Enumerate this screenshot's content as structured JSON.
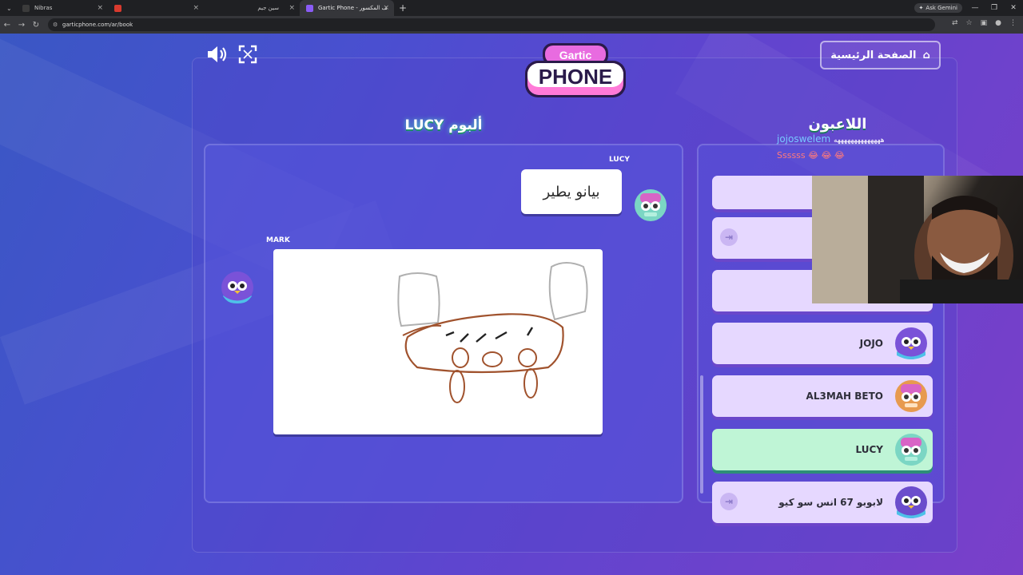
{
  "browser": {
    "tabs": [
      {
        "label": "Nibras",
        "favicon_color": "#3b3b3b"
      },
      {
        "label": "",
        "favicon_color": "#d83a2e"
      },
      {
        "label": "سين جيم",
        "favicon_color": "#2b2b2b"
      },
      {
        "label": "Gartic Phone - الهاتف المكسور",
        "favicon_color": "#8a5cf6"
      }
    ],
    "ask_gemini": "Ask Gemini",
    "url": "garticphone.com/ar/book"
  },
  "header": {
    "logo_line1": "Gartic",
    "logo_line2": "PHONE",
    "home_label": "الصفحة الرئيسية"
  },
  "album": {
    "title_word": "ألبوم",
    "title_name": "LUCY",
    "entries": [
      {
        "author": "LUCY",
        "type": "text",
        "text": "بيانو يطير"
      },
      {
        "author": "MARK",
        "type": "drawing"
      }
    ]
  },
  "players": {
    "title": "اللاعبون",
    "items": [
      {
        "name": "",
        "partial": true
      },
      {
        "name": "",
        "kick": true
      },
      {
        "name": ""
      },
      {
        "name": "JOJO",
        "avatar": "purple-bird"
      },
      {
        "name": "AL3MAH BETO",
        "avatar": "pink-robot"
      },
      {
        "name": "LUCY",
        "avatar": "pink-robot",
        "active": true
      },
      {
        "name": "لابوبو 67 انس سو كيو",
        "avatar": "purple-bird",
        "kick": true
      }
    ]
  },
  "chat": {
    "user": "jojoswelem",
    "message": "ههههههههههههههه",
    "line2": "Ssssss 😂 😂 😂"
  },
  "colors": {
    "active_player": "#bff5d6",
    "player_card": "#e6d8ff",
    "drawing_brown": "#a0522d",
    "drawing_gray": "#b0b0b0"
  }
}
